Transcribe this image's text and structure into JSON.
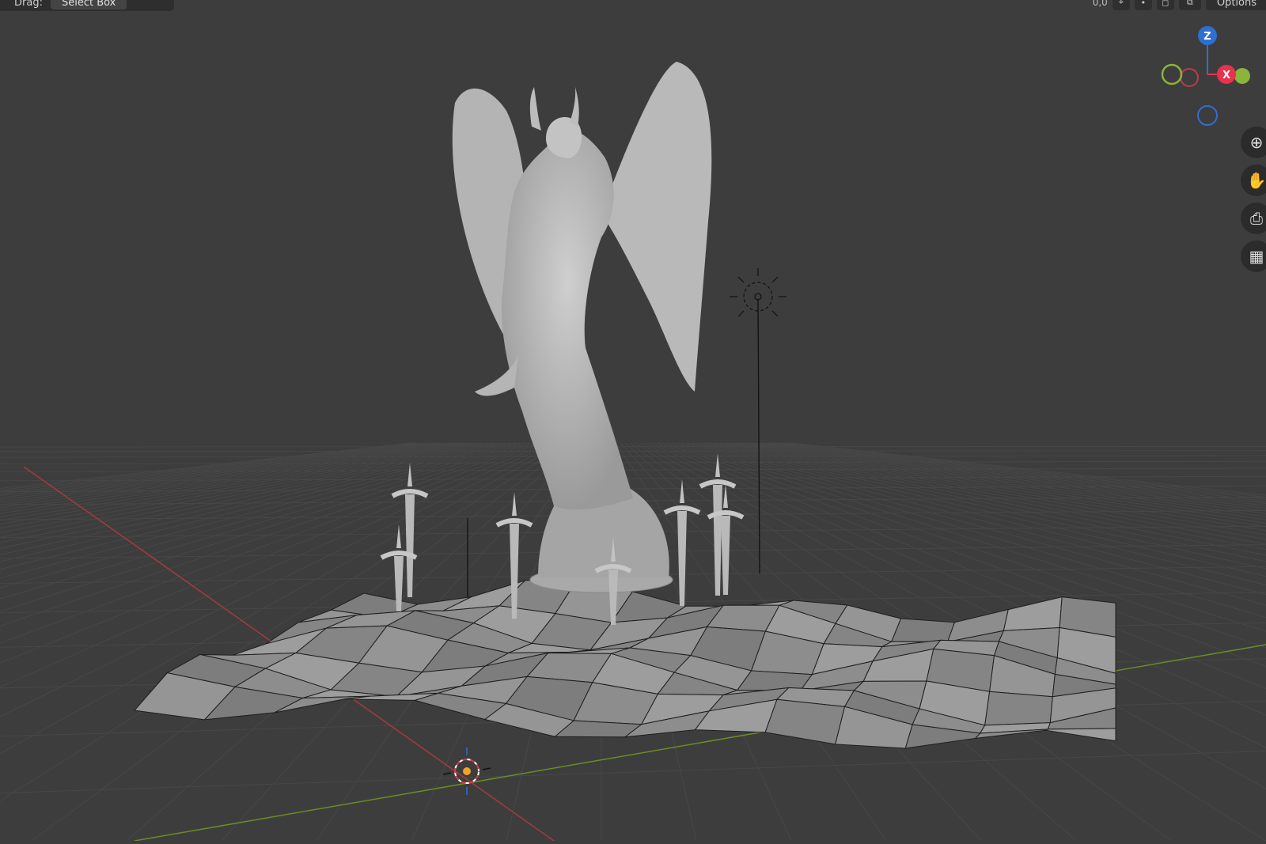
{
  "header": {
    "drag_label": "Drag:",
    "select_mode": "Select Box",
    "right_partial": "0,0",
    "options_label": "Options"
  },
  "gizmo": {
    "z_label": "Z",
    "x_label": "X",
    "colors": {
      "x": "#e8324e",
      "y": "#8ab43a",
      "z": "#2f6fd2"
    }
  },
  "navigation_icons": [
    "zoom-icon",
    "hand-pan-icon",
    "camera-view-icon",
    "perspective-toggle-icon"
  ],
  "scene": {
    "background": "#3d3d3d",
    "grid_color": "#4a4a4a",
    "x_axis_color": "#a13c3c",
    "y_axis_color": "#6a8a2a",
    "mesh_color": "#8f8f8f",
    "statue_color": "#bdbdbd"
  }
}
